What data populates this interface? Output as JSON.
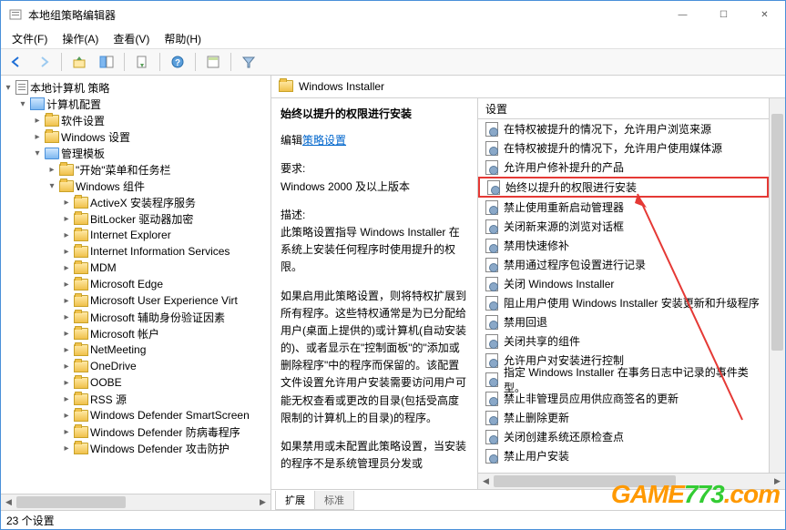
{
  "window": {
    "title": "本地组策略编辑器"
  },
  "winbtns": {
    "min": "—",
    "max": "☐",
    "close": "✕"
  },
  "menus": [
    "文件(F)",
    "操作(A)",
    "查看(V)",
    "帮助(H)"
  ],
  "tree": {
    "root": "本地计算机 策略",
    "computer_config": "计算机配置",
    "software_settings": "软件设置",
    "windows_settings": "Windows 设置",
    "admin_templates": "管理模板",
    "start_taskbar": "\"开始\"菜单和任务栏",
    "windows_components": "Windows 组件",
    "items": [
      "ActiveX 安装程序服务",
      "BitLocker 驱动器加密",
      "Internet Explorer",
      "Internet Information Services",
      "MDM",
      "Microsoft Edge",
      "Microsoft User Experience Virt",
      "Microsoft 辅助身份验证因素",
      "Microsoft 帐户",
      "NetMeeting",
      "OneDrive",
      "OOBE",
      "RSS 源",
      "Windows Defender SmartScreen",
      "Windows Defender 防病毒程序",
      "Windows Defender 攻击防护"
    ]
  },
  "right_header": "Windows Installer",
  "desc": {
    "title": "始终以提升的权限进行安装",
    "edit_prefix": "编辑",
    "edit_link": "策略设置",
    "req_label": "要求:",
    "req_value": "Windows 2000 及以上版本",
    "desc_label": "描述:",
    "desc_p1": "此策略设置指导 Windows Installer 在系统上安装任何程序时使用提升的权限。",
    "desc_p2": "如果启用此策略设置，则将特权扩展到所有程序。这些特权通常是为已分配给用户(桌面上提供的)或计算机(自动安装的)、或者显示在\"控制面板\"的\"添加或删除程序\"中的程序而保留的。该配置文件设置允许用户安装需要访问用户可能无权查看或更改的目录(包括受高度限制的计算机上的目录)的程序。",
    "desc_p3": "如果禁用或未配置此策略设置，当安装的程序不是系统管理员分发或"
  },
  "list_header": "设置",
  "policies": [
    "在特权被提升的情况下，允许用户浏览来源",
    "在特权被提升的情况下，允许用户使用媒体源",
    "允许用户修补提升的产品",
    "始终以提升的权限进行安装",
    "禁止使用重新启动管理器",
    "关闭新来源的浏览对话框",
    "禁用快速修补",
    "禁用通过程序包设置进行记录",
    "关闭 Windows Installer",
    "阻止用户使用 Windows Installer 安装更新和升级程序",
    "禁用回退",
    "关闭共享的组件",
    "允许用户对安装进行控制",
    "指定 Windows Installer 在事务日志中记录的事件类型。",
    "禁止非管理员应用供应商签名的更新",
    "禁止删除更新",
    "关闭创建系统还原检查点",
    "禁止用户安装"
  ],
  "selected_index": 3,
  "tabs": {
    "extended": "扩展",
    "standard": "标准"
  },
  "status": "23 个设置"
}
